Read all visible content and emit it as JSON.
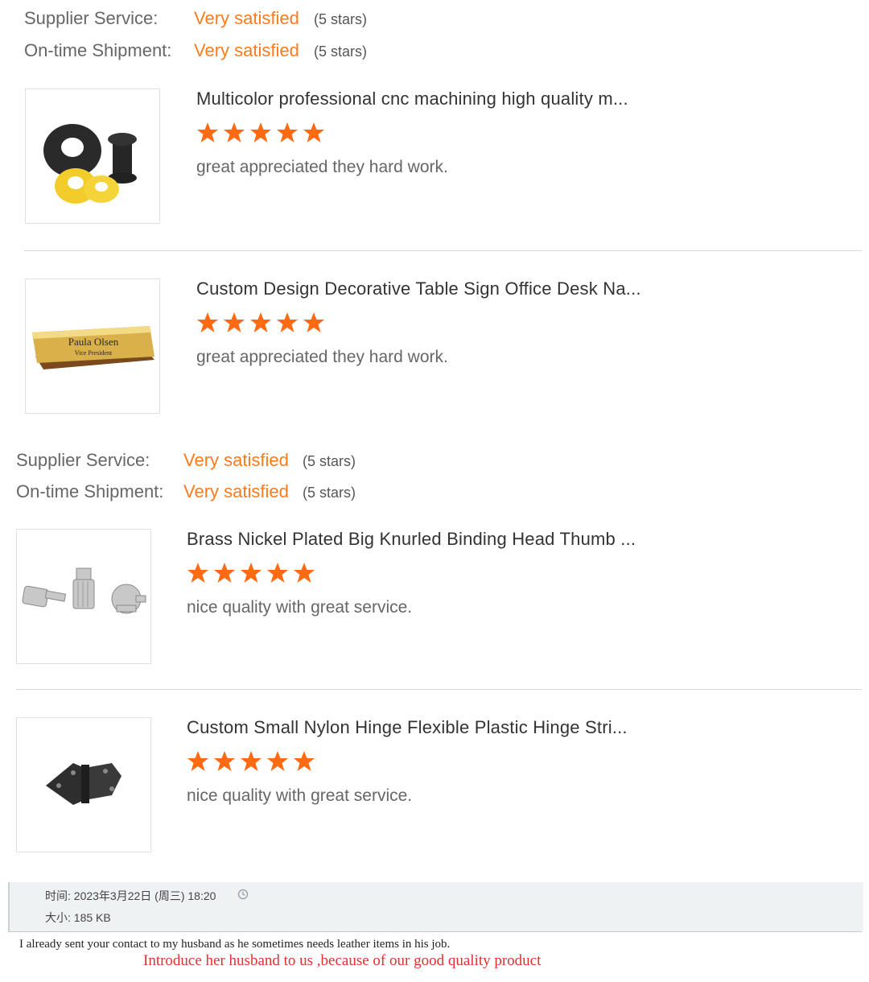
{
  "colors": {
    "accent": "#ff7a1a",
    "star": "#ff6a13",
    "label": "#666666",
    "note": "#e03030"
  },
  "ratings_block_1": {
    "supplier_label": "Supplier Service:",
    "supplier_value": "Very satisfied",
    "supplier_stars": "(5 stars)",
    "shipment_label": "On-time Shipment:",
    "shipment_value": "Very satisfied",
    "shipment_stars": "(5 stars)"
  },
  "ratings_block_2": {
    "supplier_label": "Supplier Service:",
    "supplier_value": "Very satisfied",
    "supplier_stars": "(5 stars)",
    "shipment_label": "On-time Shipment:",
    "shipment_value": "Very satisfied",
    "shipment_stars": "(5 stars)"
  },
  "reviews": [
    {
      "title": "Multicolor professional cnc machining high quality m...",
      "rating": 5,
      "comment": "great appreciated they hard work.",
      "image_icon": "rubber-rings-product-icon"
    },
    {
      "title": "Custom Design Decorative Table Sign Office Desk Na...",
      "rating": 5,
      "comment": "great appreciated they hard work.",
      "image_icon": "desk-nameplate-product-icon",
      "image_text": [
        "Paula Olsen",
        "Vice President"
      ]
    },
    {
      "title": "Brass Nickel Plated Big Knurled Binding Head Thumb ...",
      "rating": 5,
      "comment": "nice quality with great service.",
      "image_icon": "thumb-screws-product-icon"
    },
    {
      "title": "Custom Small Nylon Hinge Flexible Plastic Hinge Stri...",
      "rating": 5,
      "comment": "nice quality with great service.",
      "image_icon": "plastic-hinge-product-icon"
    }
  ],
  "email": {
    "time_line": "时间: 2023年3月22日 (周三) 18:20",
    "size_line": "大小: 185 KB",
    "clock_icon": "history-clock-icon",
    "message": "I already sent your contact to my husband as he sometimes needs leather items in his job.",
    "note": "Introduce her husband to us ,because of our good quality product"
  }
}
